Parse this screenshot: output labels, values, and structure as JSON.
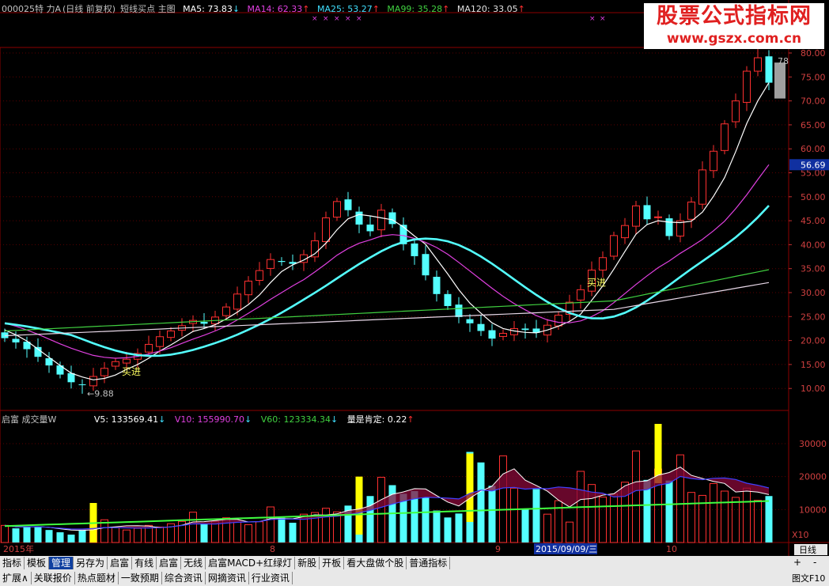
{
  "header": {
    "code_name": "000025特  力A",
    "period": "(日线 前复权)",
    "formula": "短线买点 主图",
    "ma5": "MA5: 73.83",
    "ma14": "MA14: 62.33",
    "ma25": "MA25: 53.27",
    "ma99": "MA99: 35.28",
    "ma120": "MA120: 33.05",
    "arrow_up": "↑",
    "arrow_down": "↓"
  },
  "watermark": {
    "line1": "股票公式指标网",
    "line2": "www.gszx.com.cn"
  },
  "price_axis": [
    "80.00",
    "75.00",
    "70.00",
    "65.00",
    "60.00",
    "55.00",
    "50.00",
    "45.00",
    "40.00",
    "35.00",
    "30.00",
    "25.00",
    "20.00",
    "15.00",
    "10.00"
  ],
  "price_labels": {
    "high": "78",
    "low": "9.88",
    "current": "56.69"
  },
  "signals": [
    "买进",
    "买进"
  ],
  "volume_header": {
    "name": "启富 成交量W",
    "v5": "V5: 133569.41",
    "v10": "V10: 155990.70",
    "v60": "V60: 123334.34",
    "confirm": "量是肯定: 0.22"
  },
  "volume_axis": [
    "30000",
    "20000",
    "10000"
  ],
  "volume_unit": "X10",
  "date_axis": {
    "year": "2015年",
    "m8": "8",
    "m9": "9",
    "cursor": "2015/09/09/三",
    "m10": "10",
    "period": "日线"
  },
  "toolbar_row1": [
    "指标",
    "模板",
    "管理",
    "另存为",
    "启富",
    "有线",
    "启富",
    "无线",
    "启富MACD+红绿灯",
    "新股",
    "开板",
    "看大盘做个股",
    "普通指标"
  ],
  "toolbar_row1_selected": "管理",
  "toolbar_row2": [
    "扩展∧",
    "关联报价",
    "热点题材",
    "一致预期",
    "综合资讯",
    "网摘资讯",
    "行业资讯"
  ],
  "right_buttons": {
    "plus": "+",
    "minus": "-",
    "tuwen": "图文F10"
  },
  "chart_data": {
    "type": "candlestick",
    "title": "000025特  力A (日线 前复权)",
    "y_range": [
      7,
      82
    ],
    "close": [
      20.5,
      19.6,
      18.2,
      16.6,
      14.8,
      12.9,
      11.3,
      10.7,
      12.5,
      14.2,
      15.6,
      16.1,
      17.3,
      19.2,
      20.8,
      22.0,
      23.1,
      24.2,
      23.5,
      24.9,
      27.0,
      29.7,
      32.4,
      34.6,
      36.9,
      36.4,
      36.0,
      37.9,
      40.8,
      45.6,
      49.0,
      47.2,
      44.2,
      42.8,
      47.2,
      44.3,
      40.1,
      37.6,
      33.6,
      29.7,
      27.2,
      24.9,
      23.6,
      22.0,
      20.4,
      21.5,
      22.5,
      22.2,
      21.6,
      23.2,
      25.3,
      28.0,
      30.6,
      34.7,
      37.3,
      41.9,
      44.0,
      48.1,
      45.3,
      45.8,
      41.8,
      45.0,
      48.9,
      55.6,
      59.5,
      65.2,
      70.0,
      76.2,
      79.0,
      73.8
    ],
    "ma5": [
      22.2,
      21.2,
      19.9,
      18.2,
      16.5,
      14.8,
      13.2,
      12.4,
      11.8,
      12.1,
      12.8,
      14.0,
      15.0,
      16.3,
      17.8,
      19.1,
      20.5,
      21.9,
      22.5,
      23.3,
      24.5,
      25.9,
      27.5,
      29.5,
      32.1,
      34.4,
      35.8,
      36.8,
      38.1,
      40.3,
      43.1,
      45.4,
      46.3,
      46.0,
      45.6,
      45.2,
      43.7,
      41.8,
      40.1,
      37.0,
      33.9,
      30.6,
      27.8,
      25.7,
      23.7,
      22.5,
      22.0,
      21.7,
      21.6,
      22.2,
      23.0,
      24.0,
      25.5,
      28.4,
      31.4,
      34.9,
      38.6,
      42.2,
      44.2,
      45.0,
      44.7,
      44.6,
      44.9,
      46.8,
      50.1,
      54.0,
      59.4,
      65.3,
      70.0,
      73.8
    ],
    "ma14": [
      23.6,
      23.0,
      22.2,
      21.3,
      20.3,
      19.3,
      18.4,
      17.6,
      16.9,
      16.5,
      16.3,
      16.4,
      16.7,
      17.2,
      17.8,
      18.5,
      19.4,
      20.3,
      21.1,
      22.0,
      23.0,
      24.3,
      25.7,
      27.1,
      28.6,
      30.0,
      31.4,
      32.7,
      34.3,
      36.0,
      37.8,
      39.2,
      40.3,
      41.0,
      41.8,
      42.1,
      41.9,
      41.3,
      40.5,
      39.4,
      38.0,
      36.3,
      34.5,
      32.7,
      30.9,
      29.2,
      27.7,
      26.4,
      25.2,
      24.3,
      23.8,
      23.7,
      24.1,
      25.0,
      26.2,
      27.9,
      29.8,
      31.7,
      33.5,
      35.2,
      36.6,
      38.2,
      39.6,
      41.1,
      42.9,
      44.9,
      47.5,
      50.4,
      53.6,
      56.7
    ]
  }
}
